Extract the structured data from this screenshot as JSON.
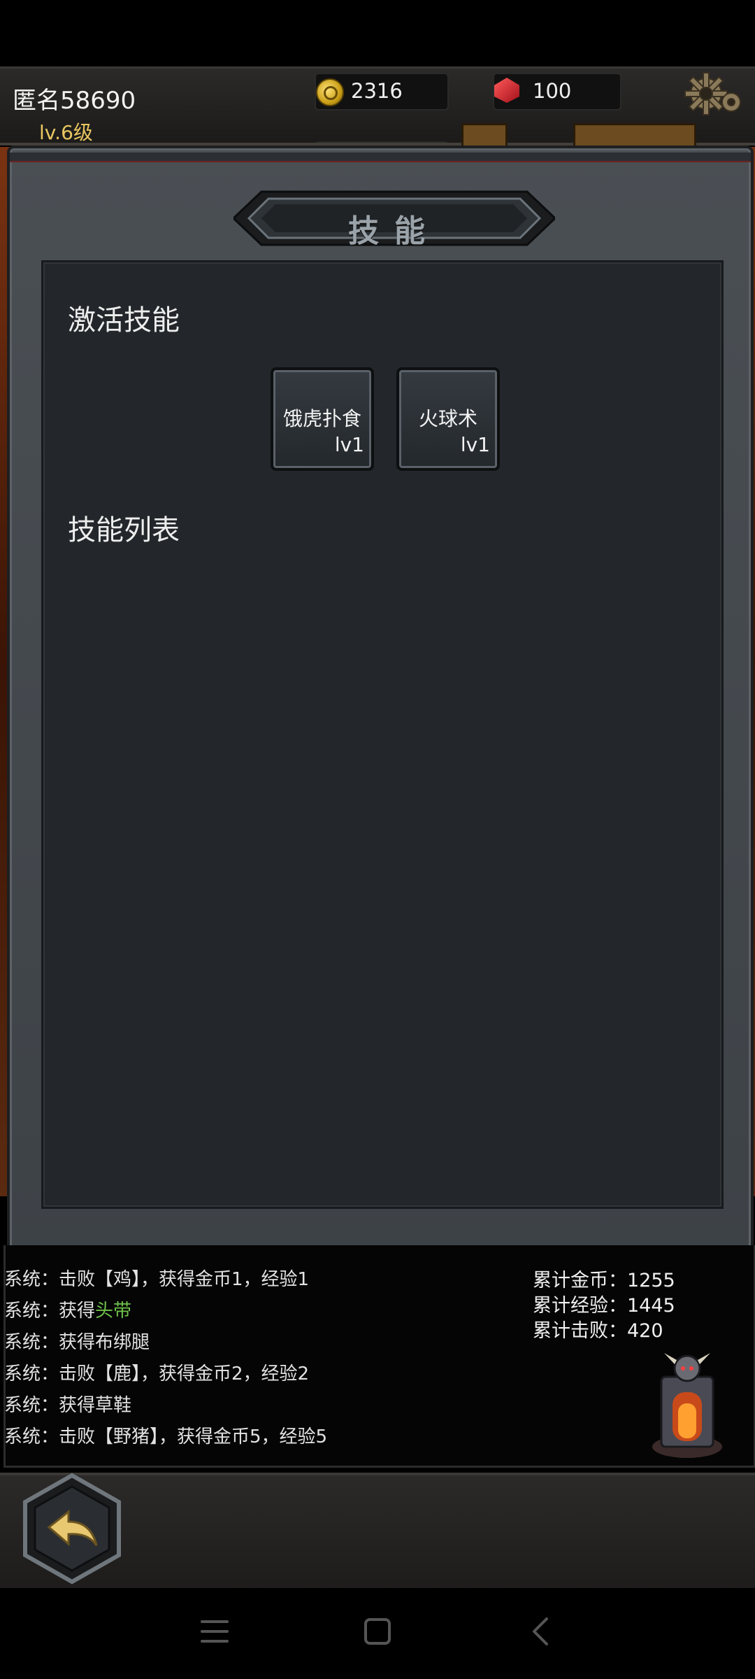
{
  "header": {
    "player_name": "匿名58690",
    "player_level": "lv.6级",
    "gold": "2316",
    "gems": "100"
  },
  "modal": {
    "title": "技能",
    "active_section_title": "激活技能",
    "list_section_title": "技能列表",
    "active_skills": [
      {
        "name": "饿虎扑食",
        "level": "lv1"
      },
      {
        "name": "火球术",
        "level": "lv1"
      }
    ]
  },
  "log": {
    "lines": [
      {
        "prefix": "系统：",
        "text": "击败【鸡】，获得金币1，经验1",
        "highlight": ""
      },
      {
        "prefix": "系统：",
        "text": "获得",
        "highlight": "头带"
      },
      {
        "prefix": "系统：",
        "text": "获得布绑腿",
        "highlight": ""
      },
      {
        "prefix": "系统：",
        "text": "击败【鹿】，获得金币2，经验2",
        "highlight": ""
      },
      {
        "prefix": "系统：",
        "text": "获得草鞋",
        "highlight": ""
      },
      {
        "prefix": "系统：",
        "text": "击败【野猪】，获得金币5，经验5",
        "highlight": ""
      }
    ],
    "stats": [
      {
        "label": "累计金币：",
        "value": "1255"
      },
      {
        "label": "累计经验：",
        "value": "1445"
      },
      {
        "label": "累计击败：",
        "value": "420"
      }
    ]
  },
  "colors": {
    "accent_gold": "#e9c660",
    "loot_green": "#6ec24a",
    "panel_bg": "#23272b"
  }
}
